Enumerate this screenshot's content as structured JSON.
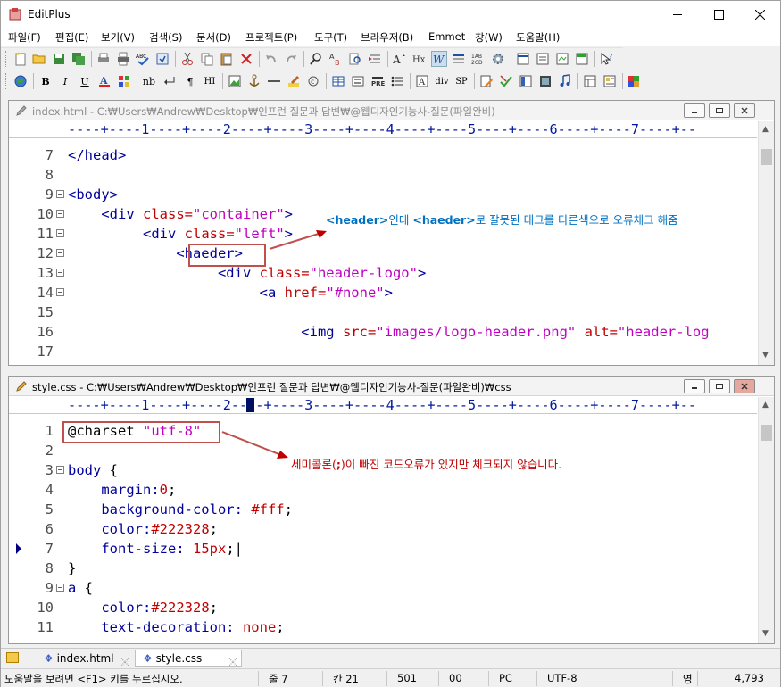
{
  "app": {
    "title": "EditPlus"
  },
  "menu": [
    "파일(F)",
    "편집(E)",
    "보기(V)",
    "검색(S)",
    "문서(D)",
    "프로젝트(P)",
    "도구(T)",
    "브라우저(B)",
    "Emmet",
    "창(W)",
    "도움말(H)"
  ],
  "toolbar2_text": {
    "nb": "nb",
    "para": "¶",
    "hi": "HI",
    "div": "div",
    "sp": "SP"
  },
  "doc1": {
    "title": "index.html - C:₩Users₩Andrew₩Desktop₩인프런 질문과 답변₩@웹디자인기능사-질문(파일완비)",
    "ruler": "----+----1----+----2----+----3----+----4----+----5----+----6----+----7----+--",
    "lines": [
      {
        "num": "7",
        "fold": false,
        "parts": [
          {
            "t": "</head>",
            "c": "c-tag"
          }
        ]
      },
      {
        "num": "8",
        "fold": false,
        "parts": []
      },
      {
        "num": "9",
        "fold": true,
        "parts": [
          {
            "t": "<body>",
            "c": "c-tag"
          }
        ]
      },
      {
        "num": "10",
        "fold": true,
        "parts": [
          {
            "t": "    <div ",
            "c": "c-tag"
          },
          {
            "t": "class=",
            "c": "c-attr"
          },
          {
            "t": "\"container\"",
            "c": "c-str"
          },
          {
            "t": ">",
            "c": "c-tag"
          }
        ]
      },
      {
        "num": "11",
        "fold": true,
        "parts": [
          {
            "t": "         <div ",
            "c": "c-tag"
          },
          {
            "t": "class=",
            "c": "c-attr"
          },
          {
            "t": "\"left\"",
            "c": "c-str"
          },
          {
            "t": ">",
            "c": "c-tag"
          }
        ]
      },
      {
        "num": "12",
        "fold": true,
        "parts": [
          {
            "t": "             <haeder>",
            "c": "c-tag"
          }
        ]
      },
      {
        "num": "13",
        "fold": true,
        "parts": [
          {
            "t": "                  <div ",
            "c": "c-tag"
          },
          {
            "t": "class=",
            "c": "c-attr"
          },
          {
            "t": "\"header-logo\"",
            "c": "c-str"
          },
          {
            "t": ">",
            "c": "c-tag"
          }
        ]
      },
      {
        "num": "14",
        "fold": true,
        "parts": [
          {
            "t": "                       <a ",
            "c": "c-tag"
          },
          {
            "t": "href=",
            "c": "c-attr"
          },
          {
            "t": "\"#none\"",
            "c": "c-str"
          },
          {
            "t": ">",
            "c": "c-tag"
          }
        ]
      },
      {
        "num": "15",
        "fold": false,
        "parts": []
      },
      {
        "num": "16",
        "fold": false,
        "parts": [
          {
            "t": "                            <img ",
            "c": "c-tag"
          },
          {
            "t": "src=",
            "c": "c-attr"
          },
          {
            "t": "\"images/logo-header.png\"",
            "c": "c-str"
          },
          {
            "t": " ",
            "c": "c-plain"
          },
          {
            "t": "alt=",
            "c": "c-attr"
          },
          {
            "t": "\"header-log",
            "c": "c-str"
          }
        ]
      },
      {
        "num": "17",
        "fold": false,
        "parts": []
      }
    ],
    "note": {
      "p1": "<header>",
      "p2": "인데 ",
      "p3": "<haeder>",
      "p4": "로 잘못된 태그를 다른색으로 오류체크 해줌"
    }
  },
  "doc2": {
    "title": "style.css - C:₩Users₩Andrew₩Desktop₩인프런 질문과 답변₩@웹디자인기능사-질문(파일완비)₩css",
    "ruler": "----+----1----+----2----+----3----+----4----+----5----+----6----+----7----+--",
    "lines": [
      {
        "num": "1",
        "fold": false,
        "parts": [
          {
            "t": "@charset ",
            "c": "c-plain"
          },
          {
            "t": "\"utf-8\"",
            "c": "c-str"
          }
        ]
      },
      {
        "num": "2",
        "fold": false,
        "parts": []
      },
      {
        "num": "3",
        "fold": true,
        "parts": [
          {
            "t": "body ",
            "c": "c-sel"
          },
          {
            "t": "{",
            "c": "c-plain"
          }
        ]
      },
      {
        "num": "4",
        "fold": false,
        "parts": [
          {
            "t": "    margin:",
            "c": "c-prop"
          },
          {
            "t": "0",
            "c": "c-val"
          },
          {
            "t": ";",
            "c": "c-plain"
          }
        ]
      },
      {
        "num": "5",
        "fold": false,
        "parts": [
          {
            "t": "    background-color: ",
            "c": "c-prop"
          },
          {
            "t": "#fff",
            "c": "c-val"
          },
          {
            "t": ";",
            "c": "c-plain"
          }
        ]
      },
      {
        "num": "6",
        "fold": false,
        "parts": [
          {
            "t": "    color:",
            "c": "c-prop"
          },
          {
            "t": "#222328",
            "c": "c-val"
          },
          {
            "t": ";",
            "c": "c-plain"
          }
        ]
      },
      {
        "num": "7",
        "fold": false,
        "parts": [
          {
            "t": "    font-size: ",
            "c": "c-prop"
          },
          {
            "t": "15px",
            "c": "c-val"
          },
          {
            "t": ";|",
            "c": "c-plain"
          }
        ]
      },
      {
        "num": "8",
        "fold": false,
        "parts": [
          {
            "t": "}",
            "c": "c-plain"
          }
        ]
      },
      {
        "num": "9",
        "fold": true,
        "parts": [
          {
            "t": "a ",
            "c": "c-sel"
          },
          {
            "t": "{",
            "c": "c-plain"
          }
        ]
      },
      {
        "num": "10",
        "fold": false,
        "parts": [
          {
            "t": "    color:",
            "c": "c-prop"
          },
          {
            "t": "#222328",
            "c": "c-val"
          },
          {
            "t": ";",
            "c": "c-plain"
          }
        ]
      },
      {
        "num": "11",
        "fold": false,
        "parts": [
          {
            "t": "    text-decoration: ",
            "c": "c-prop"
          },
          {
            "t": "none",
            "c": "c-val"
          },
          {
            "t": ";",
            "c": "c-plain"
          }
        ]
      }
    ],
    "note": {
      "p1": "세미콜론(",
      "p2": ";",
      "p3": ")이 빠진 코드오류가 있지만 체크되지 않습니다."
    }
  },
  "tabs": [
    {
      "label": "index.html",
      "active": false
    },
    {
      "label": "style.css",
      "active": true
    }
  ],
  "status": {
    "help": "도움말을 보려면 <F1> 키를 누르십시오.",
    "line": "줄 7",
    "col": "칸 21",
    "total": "501",
    "sel": "00",
    "eol": "PC",
    "enc": "UTF-8",
    "mode": "영",
    "size": "4,793"
  },
  "colors": {
    "annotation_box": "#c0504d",
    "note_blue": "#0070c0",
    "note_red": "#c00000",
    "ruler_blue": "#001a9e"
  }
}
